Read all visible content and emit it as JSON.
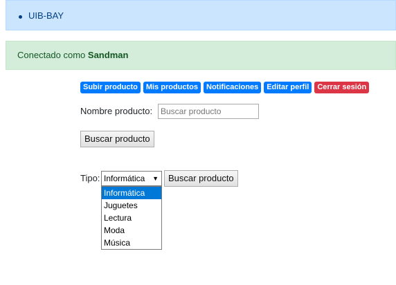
{
  "nav": {
    "brand": "UIB-BAY"
  },
  "alert": {
    "prefix": "Conectado como ",
    "username": "Sandman"
  },
  "actions": [
    {
      "label": "Subir producto",
      "color": "#007bff"
    },
    {
      "label": "Mis productos",
      "color": "#007bff"
    },
    {
      "label": "Notificaciones",
      "color": "#007bff"
    },
    {
      "label": "Editar perfil",
      "color": "#007bff"
    },
    {
      "label": "Cerrar sesión",
      "color": "#dc3545"
    }
  ],
  "search_name": {
    "label": "Nombre producto:",
    "placeholder": "Buscar producto",
    "button": "Buscar producto"
  },
  "search_type": {
    "label": "Tipo:",
    "selected": "Informática",
    "button": "Buscar producto",
    "options": [
      "Informática",
      "Juguetes",
      "Lectura",
      "Moda",
      "Música"
    ]
  }
}
